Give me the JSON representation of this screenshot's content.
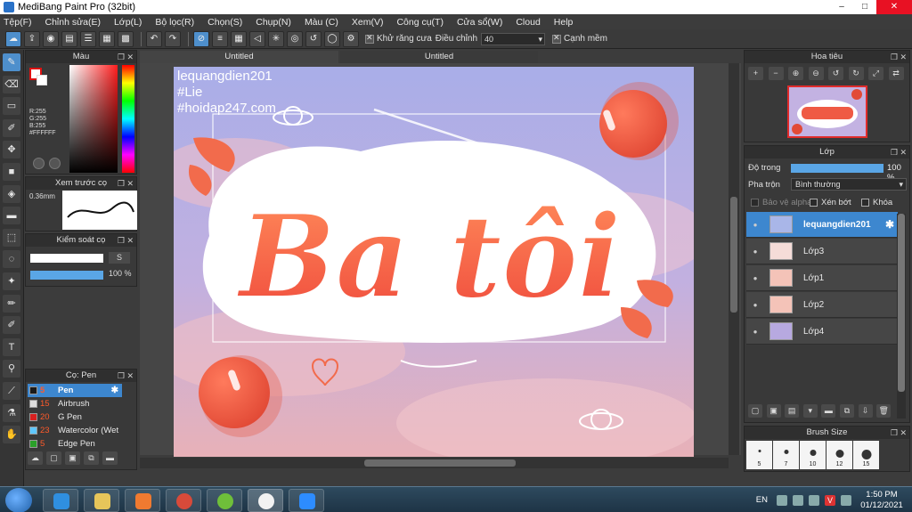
{
  "window": {
    "title": "MediBang Paint Pro (32bit)",
    "minimize": "–",
    "maximize": "□",
    "close": "✕"
  },
  "menu": [
    "Tệp(F)",
    "Chỉnh sửa(E)",
    "Lớp(L)",
    "Bộ lọc(R)",
    "Chọn(S)",
    "Chụp(N)",
    "Màu (C)",
    "Xem(V)",
    "Công cụ(T)",
    "Cửa sổ(W)",
    "Cloud",
    "Help"
  ],
  "toolbar": {
    "antialias_label": "Khử răng cưa",
    "adjust_label": "Điều chỉnh",
    "adjust_value": "40",
    "edge_label": "Cạnh mềm"
  },
  "tabs": [
    "Untitled",
    "Untitled"
  ],
  "panels": {
    "color": {
      "title": "Màu",
      "r": "R:255",
      "g": "G:255",
      "b": "B:255",
      "hex": "#FFFFFF"
    },
    "brush_preview": {
      "title": "Xem trước cọ",
      "size": "0.36mm"
    },
    "brush_control": {
      "title": "Kiểm soát cọ",
      "size_button": "S",
      "opacity": "100 %"
    },
    "brush_list": {
      "title": "Cọ: Pen",
      "items": [
        {
          "size": "5",
          "name": "Pen",
          "color": "#1a1a1a",
          "selected": true
        },
        {
          "size": "15",
          "name": "Airbrush",
          "color": "#dddddd",
          "selected": false
        },
        {
          "size": "20",
          "name": "G Pen",
          "color": "#d62020",
          "selected": false
        },
        {
          "size": "23",
          "name": "Watercolor (Wet",
          "color": "#5fc7ff",
          "selected": false
        },
        {
          "size": "5",
          "name": "Edge Pen",
          "color": "#2aa02a",
          "selected": false
        }
      ]
    },
    "navigator": {
      "title": "Hoa tiêu"
    },
    "layers": {
      "title": "Lớp",
      "opacity_label": "Độ trong",
      "opacity_value": "100 %",
      "blend_label": "Pha trộn",
      "blend_value": "Bình thường",
      "protect_alpha": "Bảo vệ alpha",
      "clip": "Xén bớt",
      "lock": "Khóa",
      "items": [
        {
          "name": "lequangdien201",
          "selected": true
        },
        {
          "name": "Lớp3",
          "selected": false
        },
        {
          "name": "Lớp1",
          "selected": false
        },
        {
          "name": "Lớp2",
          "selected": false
        },
        {
          "name": "Lớp4",
          "selected": false
        }
      ]
    },
    "brush_size": {
      "title": "Brush Size",
      "sizes": [
        "5",
        "7",
        "10",
        "12",
        "15"
      ]
    }
  },
  "artwork": {
    "watermark": [
      "lequangdien201",
      "#Lie",
      "#hoidap247.com"
    ],
    "headline": "Ba tôi",
    "colors": {
      "sky_top": "#a9aee8",
      "sky_bottom": "#e8b1b8",
      "accent": "#f26b4c",
      "outline": "#ffffff"
    }
  },
  "taskbar": {
    "lang": "EN",
    "time": "1:50 PM",
    "date": "01/12/2021"
  },
  "colors": {
    "accent_blue": "#3d87cf",
    "panel": "#393939",
    "bar_blue": "#5aa6e6"
  }
}
